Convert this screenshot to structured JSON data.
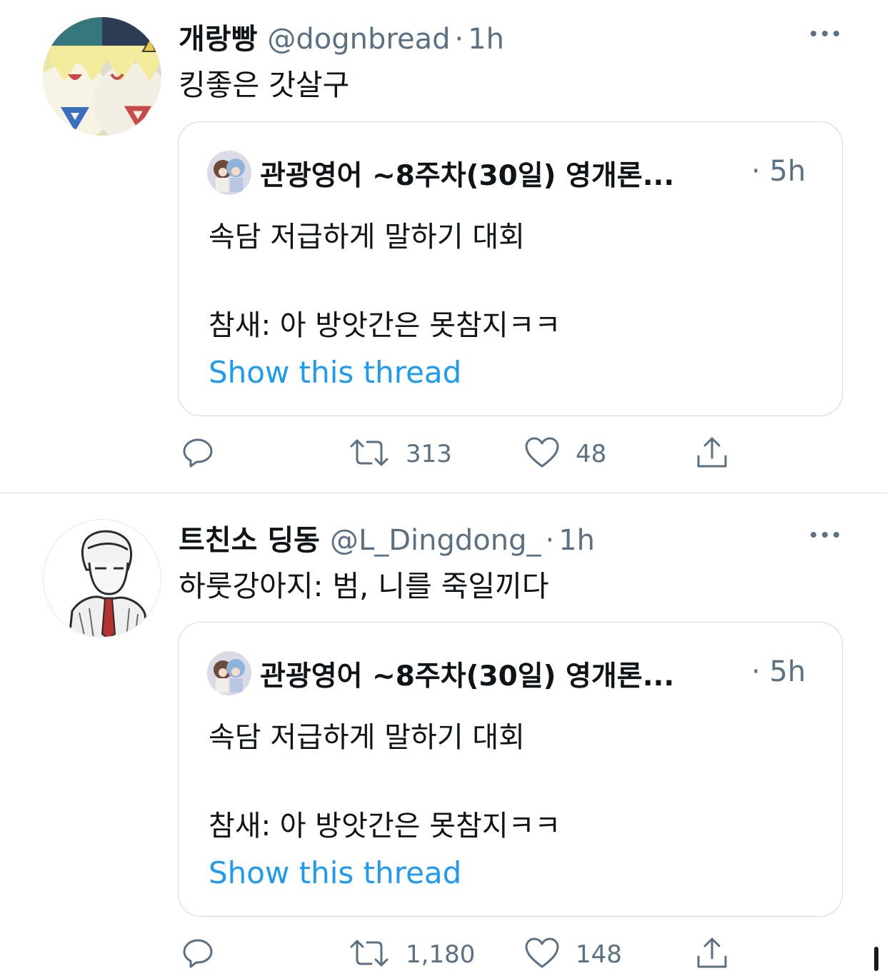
{
  "colors": {
    "link": "#1d9bf0",
    "secondary_text": "#5b7083",
    "border": "#cfd9de"
  },
  "tweets": [
    {
      "display_name": "개랑빵",
      "handle": "@dognbread",
      "separator": "·",
      "time": "1h",
      "text": "킹좋은 갓살구",
      "avatar_icon": "togepi-avatar",
      "quote": {
        "display_name": "관광영어 ~8주차(30일) 영개론...",
        "time": "· 5h",
        "lines": [
          "속담 저급하게 말하기 대회",
          "참새: 아 방앗간은 못참지ㅋㅋ"
        ],
        "link": "Show this thread"
      },
      "actions": {
        "reply_icon": "reply-icon",
        "retweet_icon": "retweet-icon",
        "retweets": "313",
        "like_icon": "heart-icon",
        "likes": "48",
        "share_icon": "share-icon"
      }
    },
    {
      "display_name": "트친소 딩동",
      "handle": "@L_Dingdong_",
      "separator": "·",
      "time": "1h",
      "text": "하룻강아지: 범, 니를 죽일끼다",
      "avatar_icon": "sketch-man-avatar",
      "quote": {
        "display_name": "관광영어 ~8주차(30일) 영개론...",
        "time": "· 5h",
        "lines": [
          "속담 저급하게 말하기 대회",
          "참새: 아 방앗간은 못참지ㅋㅋ"
        ],
        "link": "Show this thread"
      },
      "actions": {
        "reply_icon": "reply-icon",
        "retweet_icon": "retweet-icon",
        "retweets": "1,180",
        "like_icon": "heart-icon",
        "likes": "148",
        "share_icon": "share-icon"
      }
    }
  ]
}
